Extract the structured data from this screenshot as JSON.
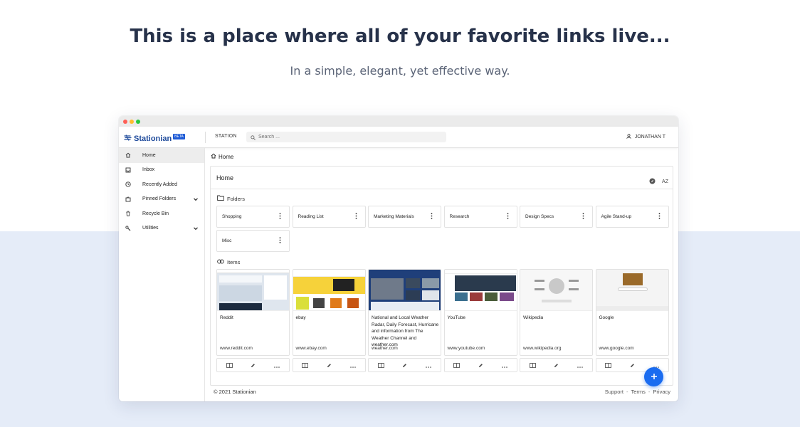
{
  "hero": {
    "title": "This is a place where all of your favorite links live...",
    "subtitle": "In a simple, elegant, yet effective way."
  },
  "app": {
    "brand": "Stationian",
    "badge": "BETA",
    "station_label": "STATION",
    "search_placeholder": "Search ...",
    "user_name": "JONATHAN T"
  },
  "sidebar": {
    "items": [
      {
        "label": "Home",
        "icon": "home-icon",
        "active": true
      },
      {
        "label": "Inbox",
        "icon": "inbox-icon"
      },
      {
        "label": "Recently Added",
        "icon": "clock-icon"
      },
      {
        "label": "Pinned Folders",
        "icon": "pin-folder-icon",
        "expandable": true
      },
      {
        "label": "Recycle Bin",
        "icon": "trash-icon"
      },
      {
        "label": "Utilities",
        "icon": "wrench-icon",
        "expandable": true
      }
    ]
  },
  "breadcrumb": {
    "label": "Home"
  },
  "panel": {
    "title": "Home",
    "sort_label": "AZ",
    "folders_label": "Folders",
    "items_label": "Items"
  },
  "folders": [
    {
      "name": "Shopping"
    },
    {
      "name": "Reading List"
    },
    {
      "name": "Marketing Materials"
    },
    {
      "name": "Research"
    },
    {
      "name": "Design Specs"
    },
    {
      "name": "Agile Stand-up"
    },
    {
      "name": "Misc"
    }
  ],
  "items": [
    {
      "title": "Reddit",
      "url": "www.reddit.com",
      "thumb_color": "#dfe6ee"
    },
    {
      "title": "ebay",
      "url": "www.ebay.com",
      "thumb_color": "#f6d23a"
    },
    {
      "title": "National and Local Weather Radar, Daily Forecast, Hurricane and information from The Weather Channel and weather.com",
      "url": "weather.com",
      "thumb_color": "#1f3f7a"
    },
    {
      "title": "YouTube",
      "url": "www.youtube.com",
      "thumb_color": "#2a3a4d"
    },
    {
      "title": "Wikipedia",
      "url": "www.wikipedia.org",
      "thumb_color": "#f7f7f7"
    },
    {
      "title": "Google",
      "url": "www.google.com",
      "thumb_color": "#f4f4f4"
    }
  ],
  "footer": {
    "copyright": "© 2021 Stationian",
    "links": [
      "Support",
      "Terms",
      "Privacy"
    ],
    "separator": "-"
  },
  "colors": {
    "accent": "#1a6cf0",
    "brand": "#1e4a9b",
    "lower_background": "#e5ecf8"
  }
}
